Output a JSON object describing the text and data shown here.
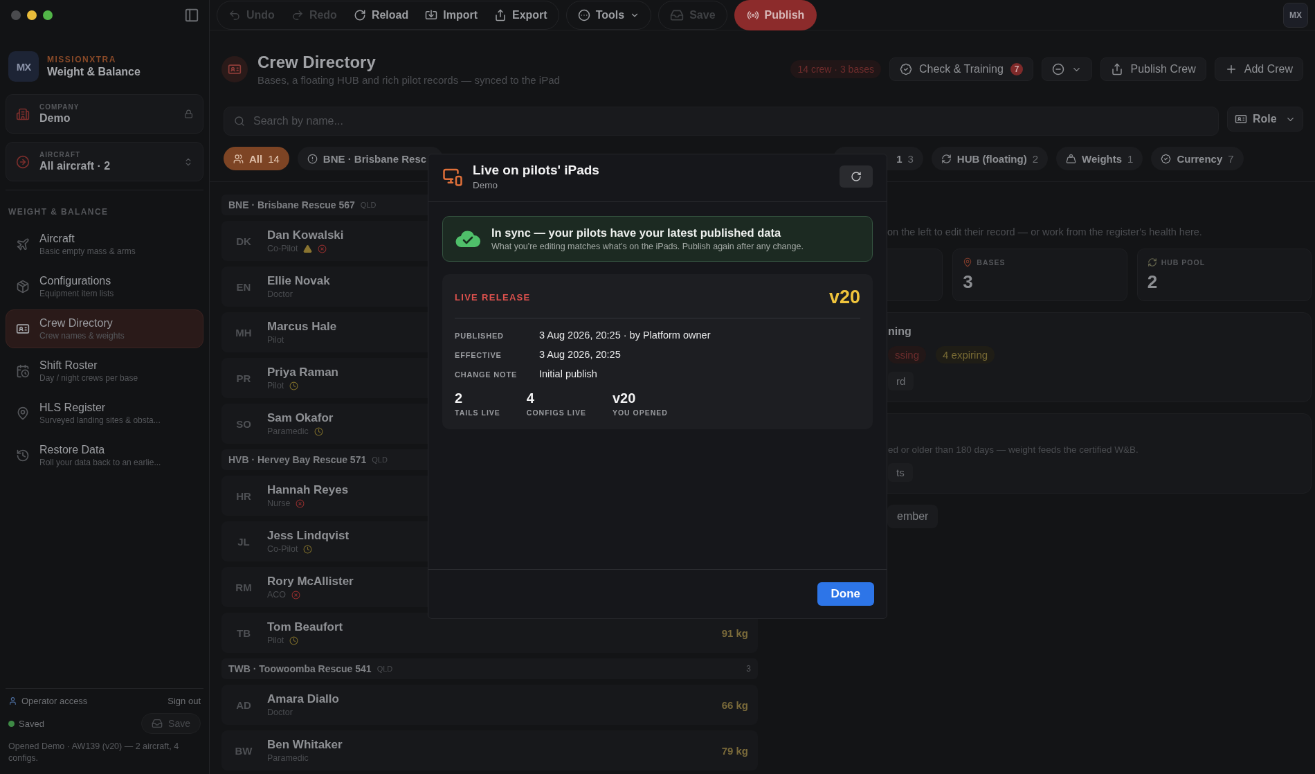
{
  "toolbar": {
    "buttons": [
      {
        "kind": "undo",
        "label": "Undo",
        "disabled": true
      },
      {
        "kind": "redo",
        "label": "Redo",
        "disabled": true
      },
      {
        "kind": "reload",
        "label": "Reload",
        "disabled": false
      },
      {
        "kind": "import",
        "label": "Import",
        "disabled": false
      },
      {
        "kind": "export",
        "label": "Export",
        "disabled": false
      }
    ],
    "tools": "Tools",
    "save": {
      "label": "Save",
      "disabled": true
    },
    "publish": "Publish",
    "avatar": "MX"
  },
  "sidebar": {
    "brand": {
      "logo": "MX",
      "name": "MISSIONXTRA",
      "product": "Weight & Balance"
    },
    "company": {
      "label": "COMPANY",
      "value": "Demo"
    },
    "aircraft": {
      "label": "AIRCRAFT",
      "value": "All aircraft · 2"
    },
    "section": "WEIGHT & BALANCE",
    "items": [
      {
        "kind": "aircraft",
        "title": "Aircraft",
        "subtitle": "Basic empty mass & arms",
        "selected": false
      },
      {
        "kind": "configurations",
        "title": "Configurations",
        "subtitle": "Equipment item lists",
        "selected": false
      },
      {
        "kind": "crew",
        "title": "Crew Directory",
        "subtitle": "Crew names & weights",
        "selected": true
      },
      {
        "kind": "roster",
        "title": "Shift Roster",
        "subtitle": "Day / night crews per base",
        "selected": false
      },
      {
        "kind": "hls",
        "title": "HLS Register",
        "subtitle": "Surveyed landing sites & obsta...",
        "selected": false
      },
      {
        "kind": "restore",
        "title": "Restore Data",
        "subtitle": "Roll your data back to an earlie...",
        "selected": false
      }
    ],
    "footer": {
      "access": "Operator access",
      "sign_out": "Sign out",
      "status": "Saved",
      "save": "Save",
      "note": "Opened Demo · AW139 (v20) — 2 aircraft, 4 configs."
    }
  },
  "page": {
    "title": "Crew Directory",
    "subtitle": "Bases, a floating HUB and rich pilot records — synced to the iPad",
    "summary": "14 crew · 3 bases",
    "check_training": {
      "label": "Check & Training",
      "count": "7"
    },
    "publish_crew": "Publish Crew",
    "add_crew": "Add Crew",
    "search": {
      "placeholder": "Search by name..."
    },
    "role_filter": "Role",
    "filters": [
      {
        "kind": "all",
        "label": "All",
        "count": "14",
        "selected": true
      },
      {
        "kind": "base",
        "label": "BNE · Brisbane Resc",
        "selected": false
      },
      {
        "kind": "partial",
        "label": "1",
        "count": "3",
        "selected": false
      },
      {
        "kind": "hub",
        "label": "HUB (floating)",
        "count": "2",
        "selected": false
      },
      {
        "kind": "weights",
        "label": "Weights",
        "count": "1",
        "selected": false
      },
      {
        "kind": "currency",
        "label": "Currency",
        "count": "7",
        "selected": false
      }
    ]
  },
  "groups": [
    {
      "name": "BNE · Brisbane Rescue 567",
      "state": "QLD",
      "crew": [
        {
          "initials": "DK",
          "name": "Dan Kowalski",
          "role": "Co-Pilot",
          "warning": true,
          "missing": true,
          "expiring": false
        },
        {
          "initials": "EN",
          "name": "Ellie Novak",
          "role": "Doctor",
          "warning": false,
          "missing": false,
          "expiring": false
        },
        {
          "initials": "MH",
          "name": "Marcus Hale",
          "role": "Pilot",
          "warning": false,
          "missing": false,
          "expiring": false
        },
        {
          "initials": "PR",
          "name": "Priya Raman",
          "role": "Pilot",
          "warning": false,
          "missing": false,
          "expiring": true
        },
        {
          "initials": "SO",
          "name": "Sam Okafor",
          "role": "Paramedic",
          "warning": false,
          "missing": false,
          "expiring": true
        }
      ]
    },
    {
      "name": "HVB · Hervey Bay Rescue 571",
      "state": "QLD",
      "crew": [
        {
          "initials": "HR",
          "name": "Hannah Reyes",
          "role": "Nurse",
          "warning": false,
          "missing": true,
          "expiring": false
        },
        {
          "initials": "JL",
          "name": "Jess Lindqvist",
          "role": "Co-Pilot",
          "warning": false,
          "missing": false,
          "expiring": true
        },
        {
          "initials": "RM",
          "name": "Rory McAllister",
          "role": "ACO",
          "warning": false,
          "missing": true,
          "expiring": false
        },
        {
          "initials": "TB",
          "name": "Tom Beaufort",
          "role": "Pilot",
          "warning": false,
          "missing": false,
          "expiring": true,
          "weight": "91 kg"
        }
      ]
    },
    {
      "name": "TWB · Toowoomba Rescue 541",
      "state": "QLD",
      "count": "3",
      "crew": [
        {
          "initials": "AD",
          "name": "Amara Diallo",
          "role": "Doctor",
          "warning": false,
          "missing": false,
          "expiring": false,
          "weight": "66 kg"
        },
        {
          "initials": "BW",
          "name": "Ben Whitaker",
          "role": "Paramedic",
          "warning": false,
          "missing": false,
          "expiring": false,
          "weight": "79 kg"
        }
      ]
    }
  ],
  "detail": {
    "intro": "on the left to edit their record — or work from the register's health here.",
    "stats": [
      {
        "kind": "bases",
        "label": "BASES",
        "value": "3"
      },
      {
        "kind": "hub",
        "label": "HUB POOL",
        "value": "2"
      }
    ],
    "training": {
      "title": "ning",
      "badges": [
        {
          "kind": "missing",
          "text": "ssing"
        },
        {
          "kind": "expiring",
          "text": "4 expiring"
        }
      ],
      "button": "rd"
    },
    "weights": {
      "text": "ed or older than 180 days — weight feeds the certified W&B.",
      "button": "ts"
    },
    "add_button": "ember"
  },
  "modal": {
    "title": "Live on pilots' iPads",
    "subtitle": "Demo",
    "status": {
      "title": "In sync — your pilots have your latest published data",
      "text": "What you're editing matches what's on the iPads. Publish again after any change."
    },
    "release": {
      "label": "LIVE RELEASE",
      "version": "v20",
      "fields": [
        {
          "label": "PUBLISHED",
          "value": "3 Aug 2026, 20:25 · by Platform owner"
        },
        {
          "label": "EFFECTIVE",
          "value": "3 Aug 2026, 20:25"
        },
        {
          "label": "CHANGE NOTE",
          "value": "Initial publish"
        }
      ],
      "stats": [
        {
          "value": "2",
          "label": "TAILS LIVE"
        },
        {
          "value": "4",
          "label": "CONFIGS LIVE"
        },
        {
          "value": "v20",
          "label": "YOU OPENED"
        }
      ]
    },
    "done": "Done"
  }
}
